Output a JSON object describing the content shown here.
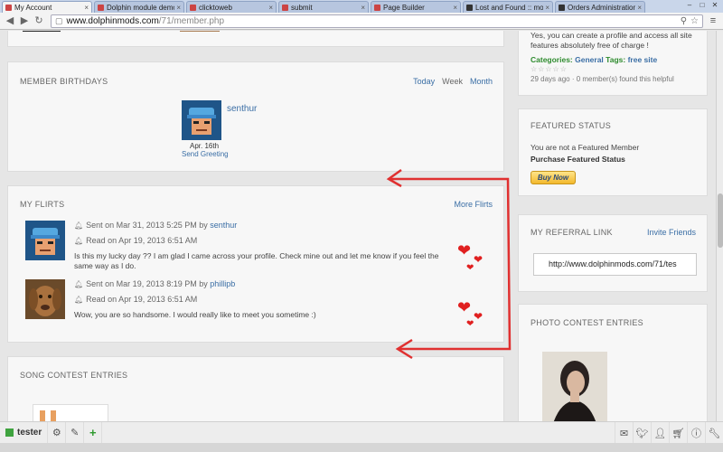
{
  "browser": {
    "tabs": [
      {
        "label": "My Account",
        "active": true,
        "color": "#c44"
      },
      {
        "label": "Dolphin module demo si",
        "active": false,
        "color": "#c44"
      },
      {
        "label": "clicktoweb",
        "active": false,
        "color": "#c44"
      },
      {
        "label": "submit",
        "active": false,
        "color": "#c44"
      },
      {
        "label": "Page Builder",
        "active": false,
        "color": "#c44"
      },
      {
        "label": "Lost and Found :: modu",
        "active": false,
        "color": "#333"
      },
      {
        "label": "Orders Administration",
        "active": false,
        "color": "#333"
      }
    ],
    "url_host": "www.dolphinmods.com",
    "url_path": "/71/member.php"
  },
  "left": {
    "birthdays": {
      "title": "MEMBER BIRTHDAYS",
      "filters": [
        "Today",
        "Week",
        "Month"
      ],
      "member_name": "senthur",
      "date": "Apr. 16th",
      "action": "Send Greeting"
    },
    "flirts": {
      "title": "MY FLIRTS",
      "more_link": "More Flirts",
      "items": [
        {
          "sent": "Sent on Mar 31, 2013 5:25 PM by",
          "sender": "senthur",
          "read": "Read on Apr 19, 2013 6:51 AM",
          "message": "Is this my lucky day ?? I am glad I came across your profile. Check mine out and let me know if you feel the same way as I do."
        },
        {
          "sent": "Sent on Mar 19, 2013 8:19 PM by",
          "sender": "phillipb",
          "read": "Read on Apr 19, 2013 6:51 AM",
          "message": "Wow, you are so handsome. I would really like to meet you sometime :)"
        }
      ]
    },
    "song_contest": {
      "title": "SONG CONTEST ENTRIES"
    }
  },
  "right": {
    "faq": {
      "text": "Yes, you can create a profile and access all site features absolutely free of charge !",
      "categories_label": "Categories:",
      "category": "General",
      "tags_label": "Tags:",
      "tag": "free site",
      "stars": "☆☆☆☆☆",
      "meta": "29 days ago  ·  0 member(s) found this helpful"
    },
    "featured": {
      "title": "FEATURED STATUS",
      "status_text": "You are not a Featured Member",
      "purchase": "Purchase Featured Status",
      "buy_button": "Buy Now"
    },
    "referral": {
      "title": "MY REFERRAL LINK",
      "invite": "Invite Friends",
      "link": "http://www.dolphinmods.com/71/tes"
    },
    "photo_contest": {
      "title": "PHOTO CONTEST ENTRIES"
    }
  },
  "bottombar": {
    "username": "tester"
  },
  "colors": {
    "accent": "#3a6ea5",
    "green": "#2e8b2e",
    "arrow": "#e03030"
  }
}
